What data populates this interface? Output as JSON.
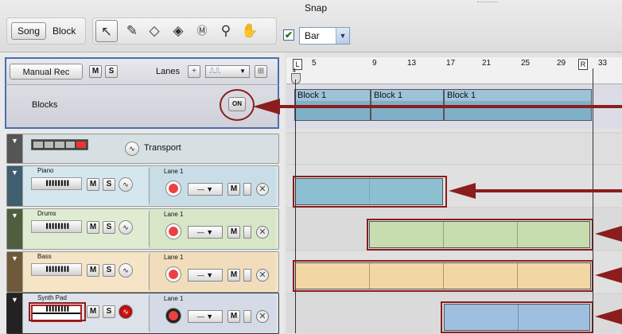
{
  "toolbar": {
    "song_label": "Song",
    "block_label": "Block",
    "snap_label": "Snap",
    "snap_value": "Bar",
    "snap_checked": "✔",
    "tools": [
      "arrow-tool-icon",
      "pencil-tool-icon",
      "eraser-tool-icon",
      "razor-tool-icon",
      "mute-tool-icon",
      "magnify-tool-icon",
      "hand-tool-icon"
    ]
  },
  "header": {
    "manual_rec_label": "Manual Rec",
    "m_label": "M",
    "s_label": "S",
    "lanes_label": "Lanes",
    "plus_label": "+",
    "blocks_label": "Blocks",
    "on_label": "ON"
  },
  "ruler": {
    "numbers": [
      "5",
      "9",
      "13",
      "17",
      "21",
      "25",
      "29",
      "33"
    ],
    "left_locator": "L",
    "right_locator": "R",
    "left_locator_sub": "4"
  },
  "block_row": {
    "blocks": [
      "Block 1",
      "Block 1",
      "Block 1"
    ]
  },
  "tracks": [
    {
      "name": "Transport",
      "type": "transport"
    },
    {
      "name": "Piano",
      "lane": "Lane 1",
      "color": "#d4e6ee"
    },
    {
      "name": "Drums",
      "lane": "Lane 1",
      "color": "#e0ecd2"
    },
    {
      "name": "Bass",
      "lane": "Lane 1",
      "color": "#f6e4c6"
    },
    {
      "name": "Synth Pad",
      "lane": "Lane 1",
      "color": "#dde2ea"
    }
  ],
  "track_buttons": {
    "m": "M",
    "s": "S"
  },
  "colors": {
    "annotation": "#8b1d1d",
    "selection_blue": "#4a6fb0",
    "piano_clip": "#8ebfd0",
    "drums_clip": "#c7ddb0",
    "bass_clip": "#f2d7a4",
    "synth_clip": "#9fbfe0"
  }
}
